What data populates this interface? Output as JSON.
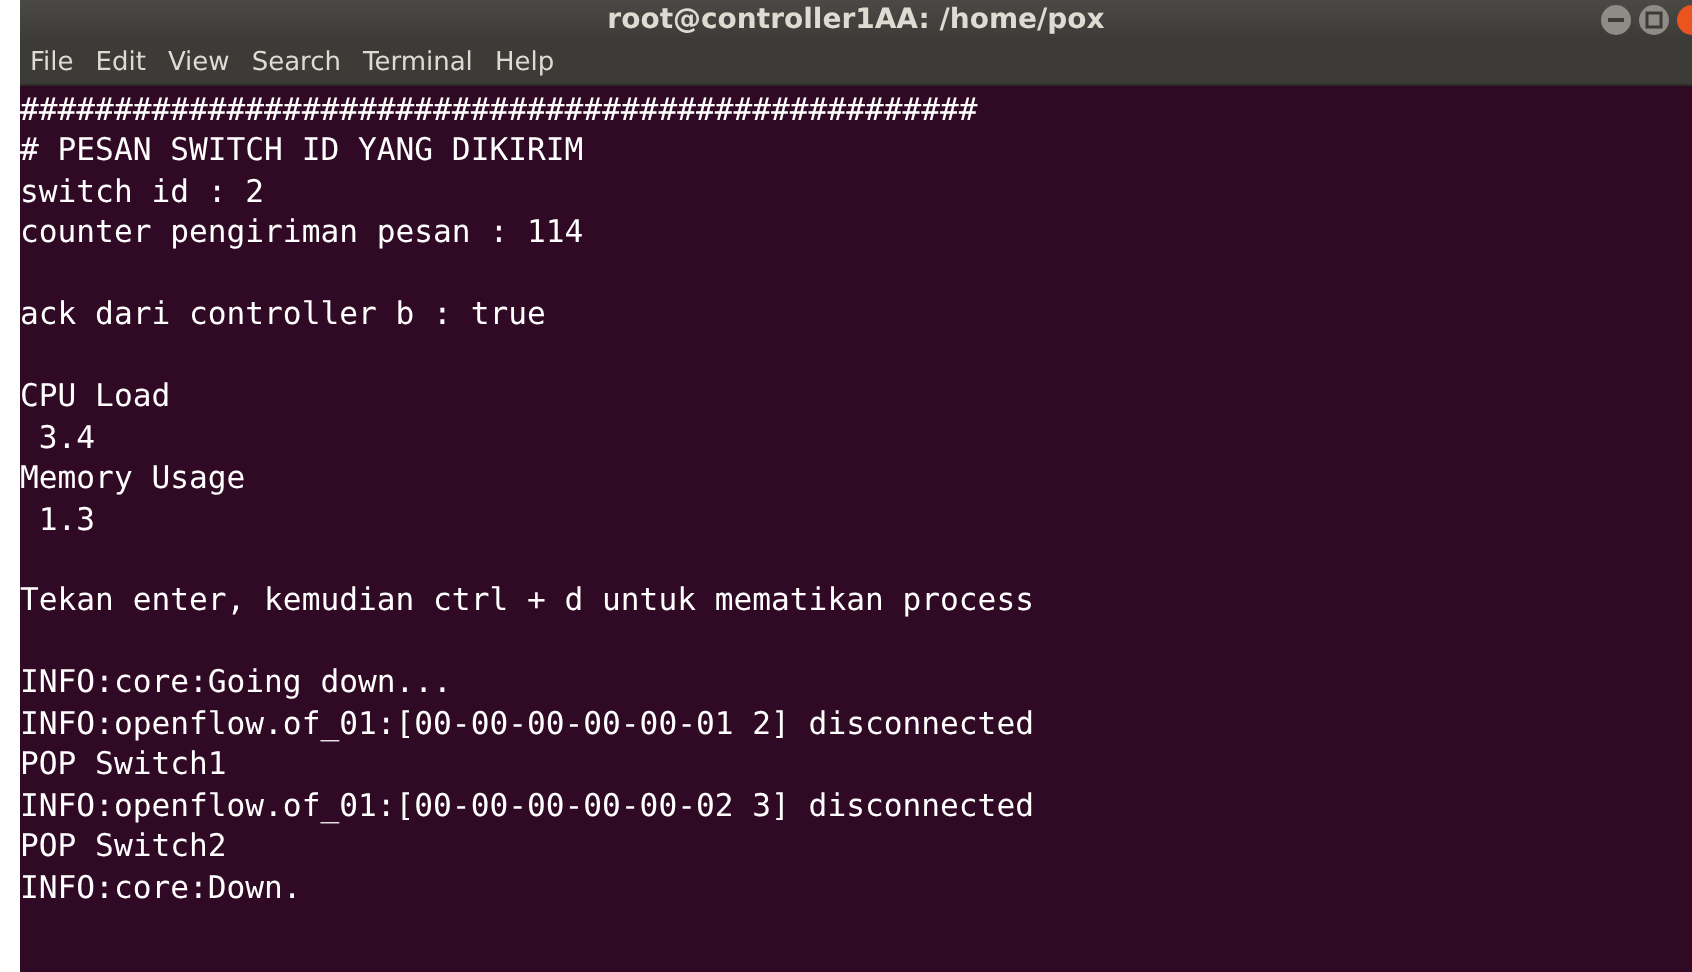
{
  "window": {
    "title": "root@controller1AA: /home/pox"
  },
  "menu": [
    "File",
    "Edit",
    "View",
    "Search",
    "Terminal",
    "Help"
  ],
  "terminal": {
    "blocks": [
      [
        "###################################################",
        "# PESAN SWITCH ID YANG DIKIRIM",
        "switch id : 2",
        "counter pengiriman pesan : 114"
      ],
      [
        "ack dari controller b : true"
      ],
      [
        "CPU Load",
        " 3.4",
        "Memory Usage",
        " 1.3"
      ],
      [
        "Tekan enter, kemudian ctrl + d untuk mematikan process"
      ],
      [
        "INFO:core:Going down...",
        "INFO:openflow.of_01:[00-00-00-00-00-01 2] disconnected",
        "POP Switch1",
        "INFO:openflow.of_01:[00-00-00-00-00-02 3] disconnected",
        "POP Switch2",
        "INFO:core:Down."
      ]
    ]
  }
}
